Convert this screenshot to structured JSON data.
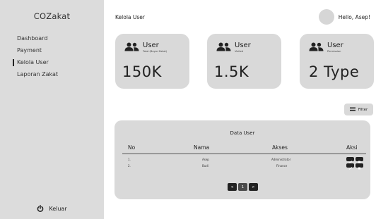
{
  "sidebar": {
    "brand": "COZakat",
    "items": [
      {
        "label": "Dashboard"
      },
      {
        "label": "Payment"
      },
      {
        "label": "Kelola User",
        "active": true
      },
      {
        "label": "Laporan Zakat"
      }
    ],
    "logout_label": "Keluar"
  },
  "header": {
    "title": "Kelola User",
    "greeting": "Hello, Asep!"
  },
  "cards": [
    {
      "title": "User",
      "subtitle": "Total (Bayar Zakat)",
      "value": "150K",
      "icon": "users-icon"
    },
    {
      "title": "User",
      "subtitle": "Visited",
      "value": "1.5K",
      "icon": "users-icon"
    },
    {
      "title": "User",
      "subtitle": "Permission",
      "value": "2 Type",
      "icon": "users-icon"
    }
  ],
  "filter": {
    "label": "Filter",
    "icon": "menu-icon"
  },
  "table": {
    "title": "Data User",
    "columns": [
      "No",
      "Nama",
      "Akses",
      "Aksi"
    ],
    "rows": [
      {
        "no": "1.",
        "nama": "Asep",
        "akses": "Administrator"
      },
      {
        "no": "2.",
        "nama": "Budi",
        "akses": "Finance"
      }
    ],
    "pagination": {
      "prev": "<",
      "current": "1",
      "next": ">"
    }
  },
  "colors": {
    "sidebar_bg": "#dcdcdc",
    "card_bg": "#d9d9d9",
    "text": "#222222",
    "button_dark": "#222222"
  }
}
